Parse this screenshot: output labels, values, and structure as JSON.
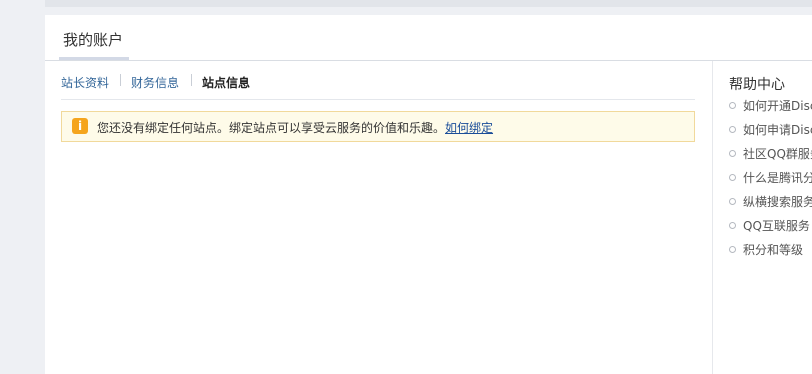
{
  "panel": {
    "title": "我的账户"
  },
  "tabs": [
    {
      "label": "站长资料",
      "active": false
    },
    {
      "label": "财务信息",
      "active": false
    },
    {
      "label": "站点信息",
      "active": true
    }
  ],
  "notice": {
    "icon": "info-icon",
    "icon_glyph": "i",
    "text": "您还没有绑定任何站点。绑定站点可以享受云服务的价值和乐趣。",
    "link_label": "如何绑定",
    "colors": {
      "background": "#fefbe9",
      "border": "#f1d99b",
      "icon": "#f5a51d"
    }
  },
  "help": {
    "title": "帮助中心",
    "items": [
      "如何开通Disc",
      "如何申请Disc",
      "社区QQ群服务",
      "什么是腾讯分",
      "纵横搜索服务",
      "QQ互联服务",
      "积分和等级"
    ]
  }
}
